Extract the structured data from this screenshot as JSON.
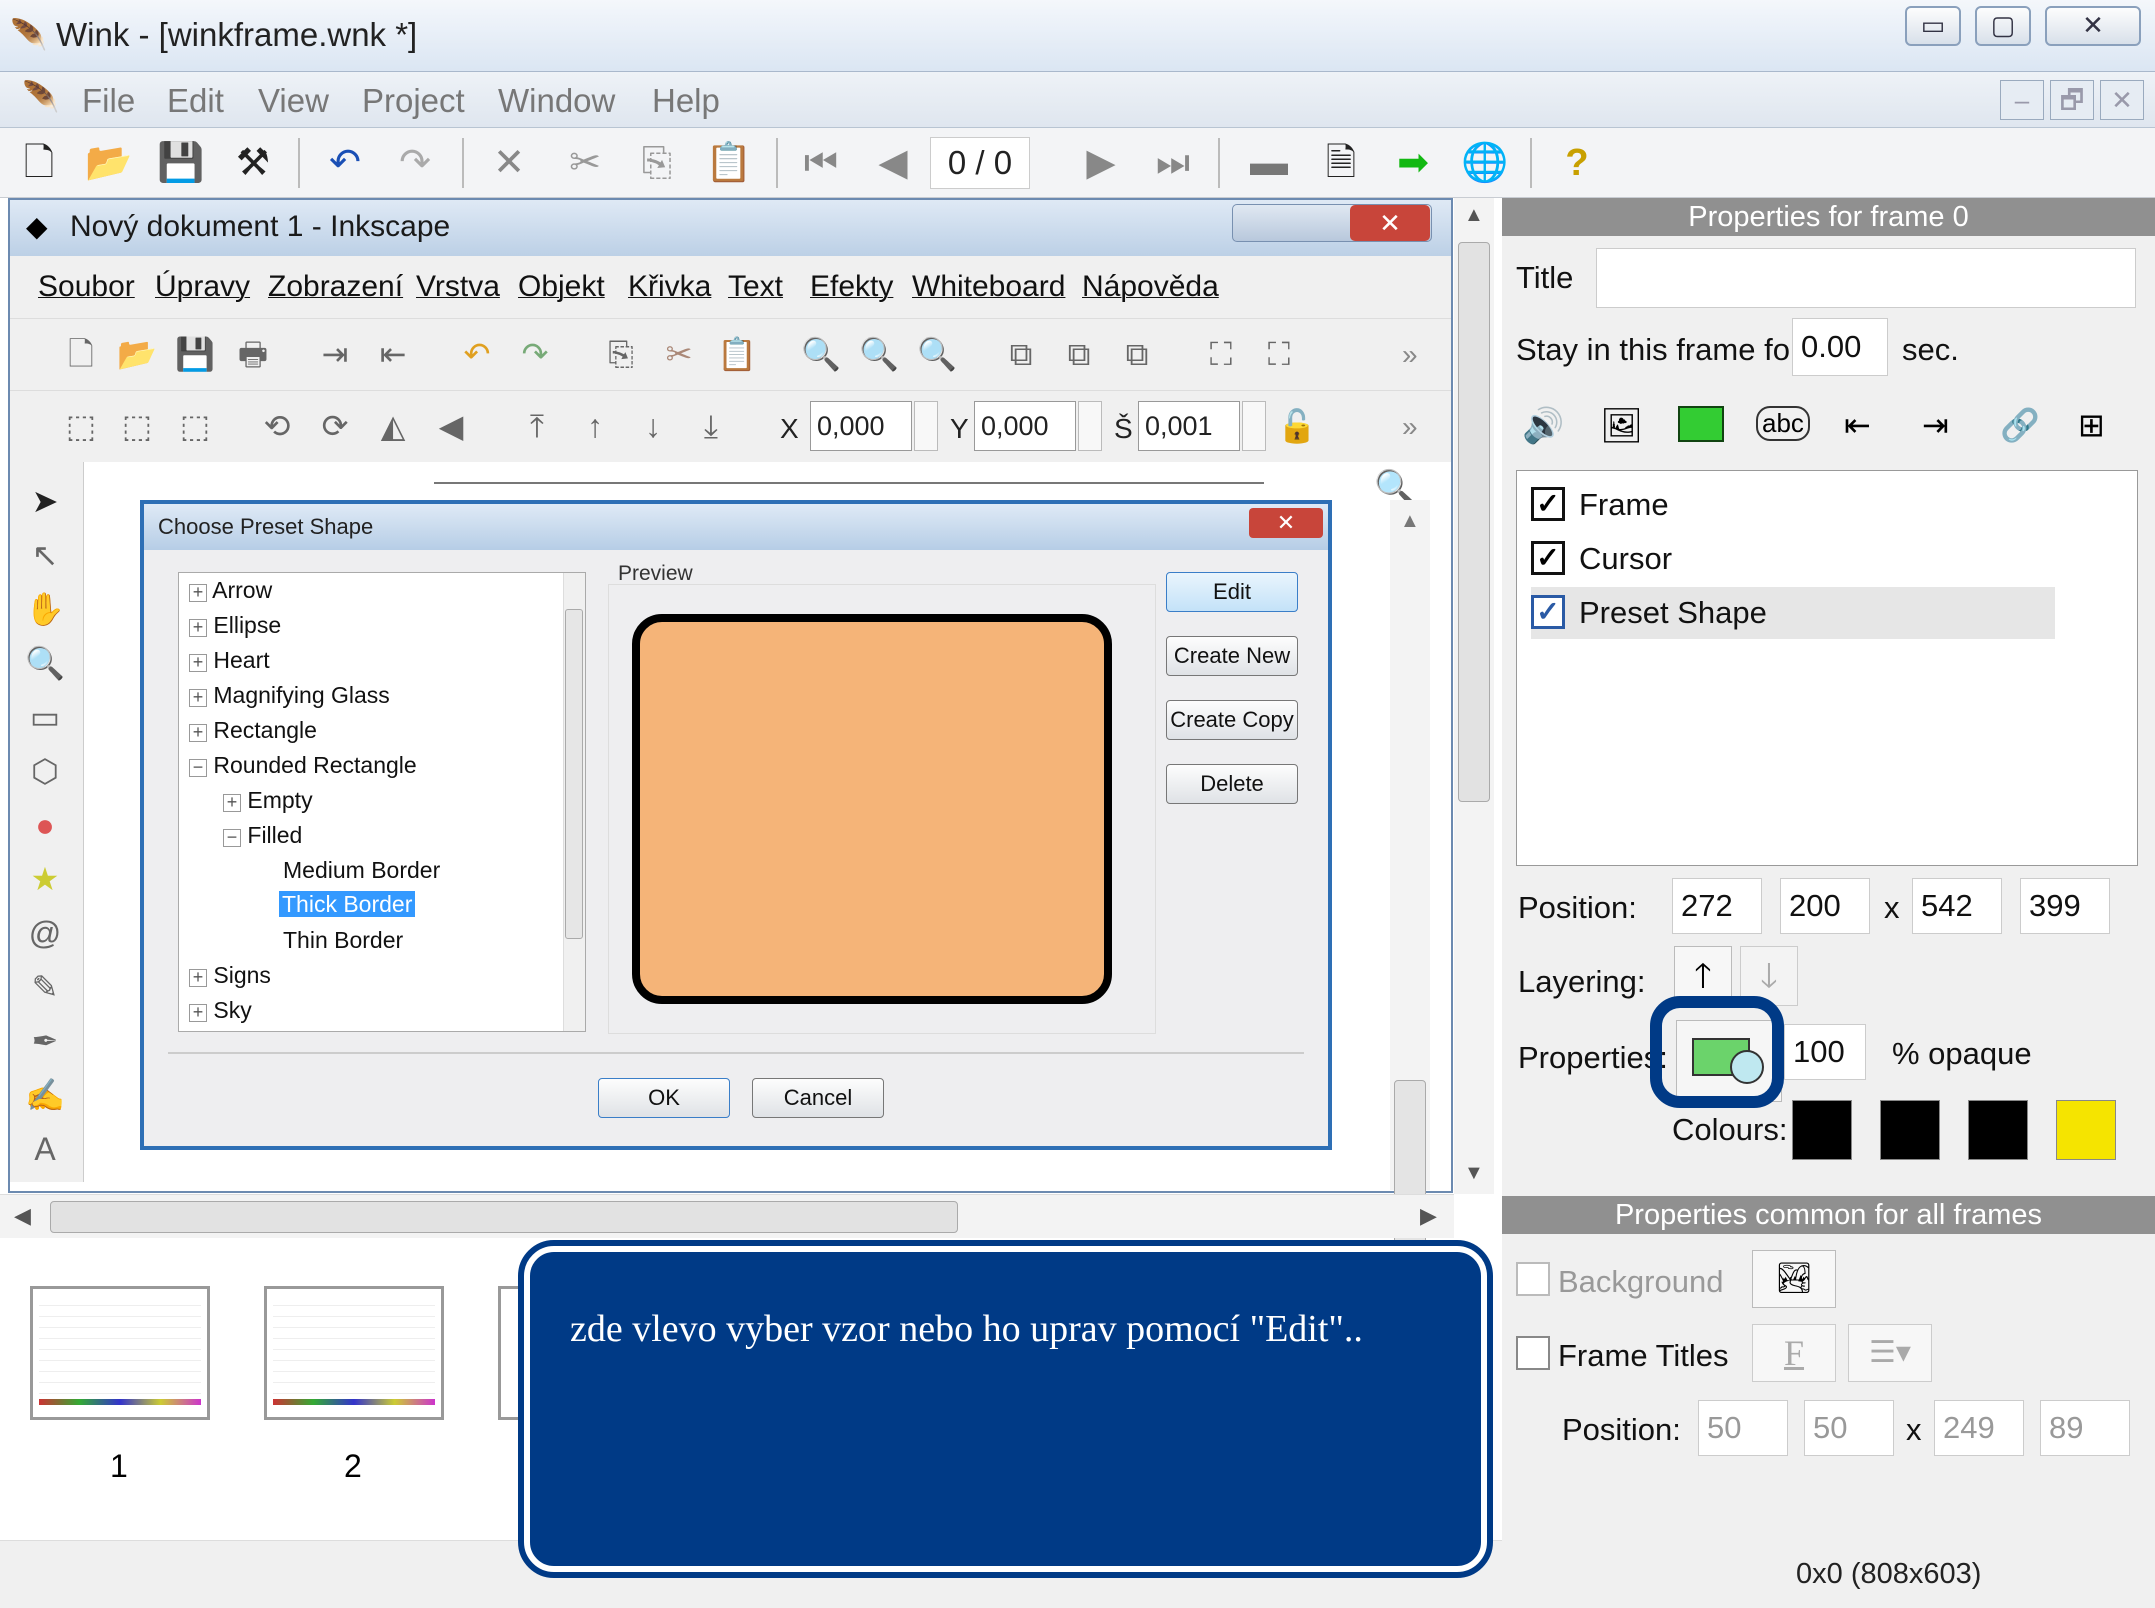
{
  "app": {
    "title": "Wink - [winkframe.wnk *]",
    "min": "▭",
    "max": "▢",
    "close": "✕"
  },
  "menu": {
    "file": "File",
    "edit": "Edit",
    "view": "View",
    "project": "Project",
    "window": "Window",
    "help": "Help",
    "mdi_min": "–",
    "mdi_restore": "🗗",
    "mdi_close": "✕"
  },
  "toolbar": {
    "frame_counter": "0 / 0"
  },
  "inkscape": {
    "title": "Nový dokument 1 - Inkscape",
    "menu": [
      "Soubor",
      "Úpravy",
      "Zobrazení",
      "Vrstva",
      "Objekt",
      "Křivka",
      "Text",
      "Efekty",
      "Whiteboard",
      "Nápověda"
    ],
    "x_label": "X",
    "x_value": "0,000",
    "y_label": "Y",
    "y_value": "0,000",
    "s_label": "Š",
    "s_value": "0,001",
    "more": "»"
  },
  "dialog": {
    "title": "Choose Preset Shape",
    "close": "✕",
    "tree": [
      "Arrow",
      "Ellipse",
      "Heart",
      "Magnifying Glass",
      "Rectangle",
      "Rounded Rectangle",
      "Empty",
      "Filled",
      "Medium Border",
      "Thick Border",
      "Thin Border",
      "Signs",
      "Sky"
    ],
    "preview_label": "Preview",
    "edit": "Edit",
    "create_new": "Create New",
    "create_copy": "Create Copy",
    "delete": "Delete",
    "ok": "OK",
    "cancel": "Cancel",
    "shape_fill": "#f5b478"
  },
  "right": {
    "header": "Properties for frame 0",
    "title_label": "Title",
    "title_value": "",
    "stay_label": "Stay in this frame for",
    "stay_value": "0.00",
    "stay_unit": "sec.",
    "items": [
      "Frame",
      "Cursor",
      "Preset Shape"
    ],
    "position_label": "Position:",
    "pos": [
      "272",
      "200",
      "542",
      "399"
    ],
    "x": "x",
    "layering_label": "Layering:",
    "properties_label": "Properties:",
    "opacity": "100",
    "opacity_unit": "% opaque",
    "colours_label": "Colours:",
    "colours": [
      "#000000",
      "#000000",
      "#000000",
      "#f5e400"
    ],
    "common_header": "Properties common for all frames",
    "background_label": "Background",
    "frame_titles_label": "Frame Titles",
    "font_btn": "F",
    "common_position_label": "Position:",
    "common_pos": [
      "50",
      "50",
      "249",
      "89"
    ],
    "status": "0x0 (808x603)"
  },
  "thumbs": {
    "labels": [
      "1",
      "2"
    ]
  },
  "callout": {
    "text": "zde vlevo vyber vzor nebo ho uprav pomocí \"Edit\".."
  },
  "accent": "#003a86"
}
